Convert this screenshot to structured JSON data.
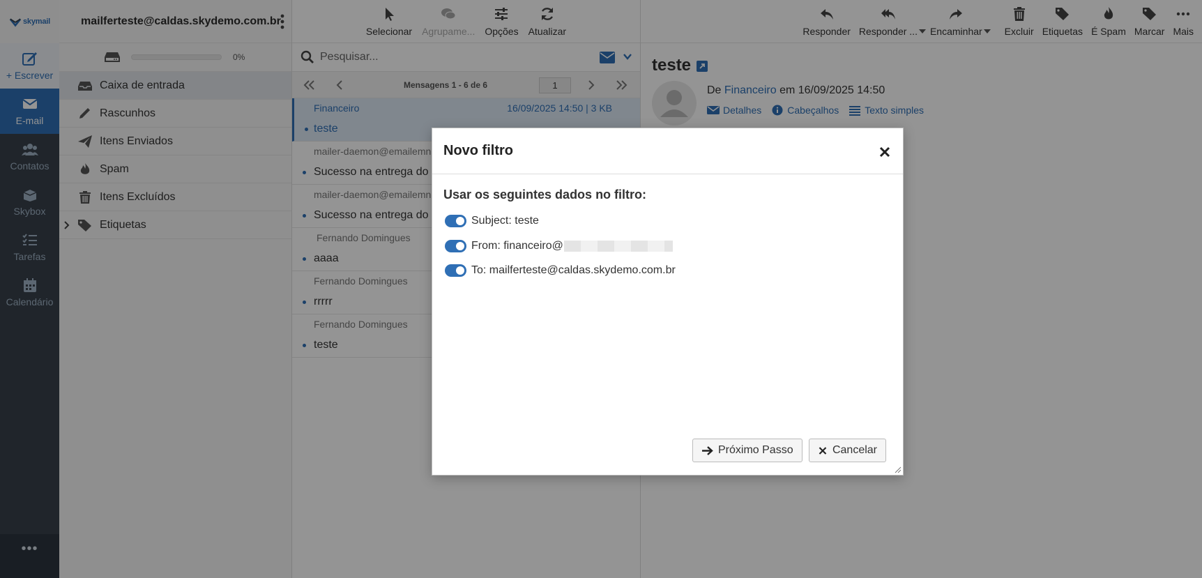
{
  "app": {
    "logo_text": "skymail"
  },
  "rail": {
    "compose": "+ Escrever",
    "items": [
      {
        "label": "E-mail"
      },
      {
        "label": "Contatos"
      },
      {
        "label": "Skybox"
      },
      {
        "label": "Tarefas"
      },
      {
        "label": "Calendário"
      }
    ],
    "more": "•••"
  },
  "account": {
    "email": "mailferteste@caldas.skydemo.com.br"
  },
  "quota": {
    "percent_label": "0%",
    "fraction": 0
  },
  "folders": [
    {
      "label": "Caixa de entrada",
      "icon": "inbox-icon"
    },
    {
      "label": "Rascunhos",
      "icon": "pencil-icon"
    },
    {
      "label": "Itens Enviados",
      "icon": "paper-plane-icon"
    },
    {
      "label": "Spam",
      "icon": "flame-icon"
    },
    {
      "label": "Itens Excluídos",
      "icon": "trash-icon"
    },
    {
      "label": "Etiquetas",
      "icon": "tag-icon"
    }
  ],
  "list_toolbar": {
    "select": "Selecionar",
    "group": "Agrupame...",
    "options": "Opções",
    "refresh": "Atualizar"
  },
  "search": {
    "placeholder": "Pesquisar..."
  },
  "pager": {
    "count": "Mensagens 1 - 6 de 6",
    "page": "1"
  },
  "messages": [
    {
      "from": "Financeiro",
      "date": "16/09/2025 14:50 | 3 KB",
      "subject": "teste"
    },
    {
      "from": "mailer-daemon@emailemn",
      "date": "",
      "subject": "Sucesso na entrega do s"
    },
    {
      "from": "mailer-daemon@emailemn",
      "date": "",
      "subject": "Sucesso na entrega do s"
    },
    {
      "from": "Fernando Domingues",
      "date": "",
      "subject": "aaaa"
    },
    {
      "from": "Fernando Domingues",
      "date": "",
      "subject": "rrrrr"
    },
    {
      "from": "Fernando Domingues",
      "date": "",
      "subject": "teste"
    }
  ],
  "reader_toolbar": {
    "reply": "Responder",
    "reply_all": "Responder ...",
    "forward": "Encaminhar",
    "delete": "Excluir",
    "labels": "Etiquetas",
    "spam": "É Spam",
    "mark": "Marcar",
    "more": "Mais"
  },
  "reader": {
    "subject": "teste",
    "from_prefix": "De",
    "from_name": "Financeiro",
    "date_text": "em 16/09/2025 14:50",
    "details": "Detalhes",
    "headers": "Cabeçalhos",
    "plain_text": "Texto simples"
  },
  "modal": {
    "title": "Novo filtro",
    "heading": "Usar os seguintes dados no filtro:",
    "rules": [
      {
        "label": "Subject: teste",
        "enabled": true
      },
      {
        "label": "From: financeiro@",
        "enabled": true
      },
      {
        "label": "To: mailferteste@caldas.skydemo.com.br",
        "enabled": true
      }
    ],
    "next_label": "Próximo Passo",
    "cancel_label": "Cancelar"
  }
}
